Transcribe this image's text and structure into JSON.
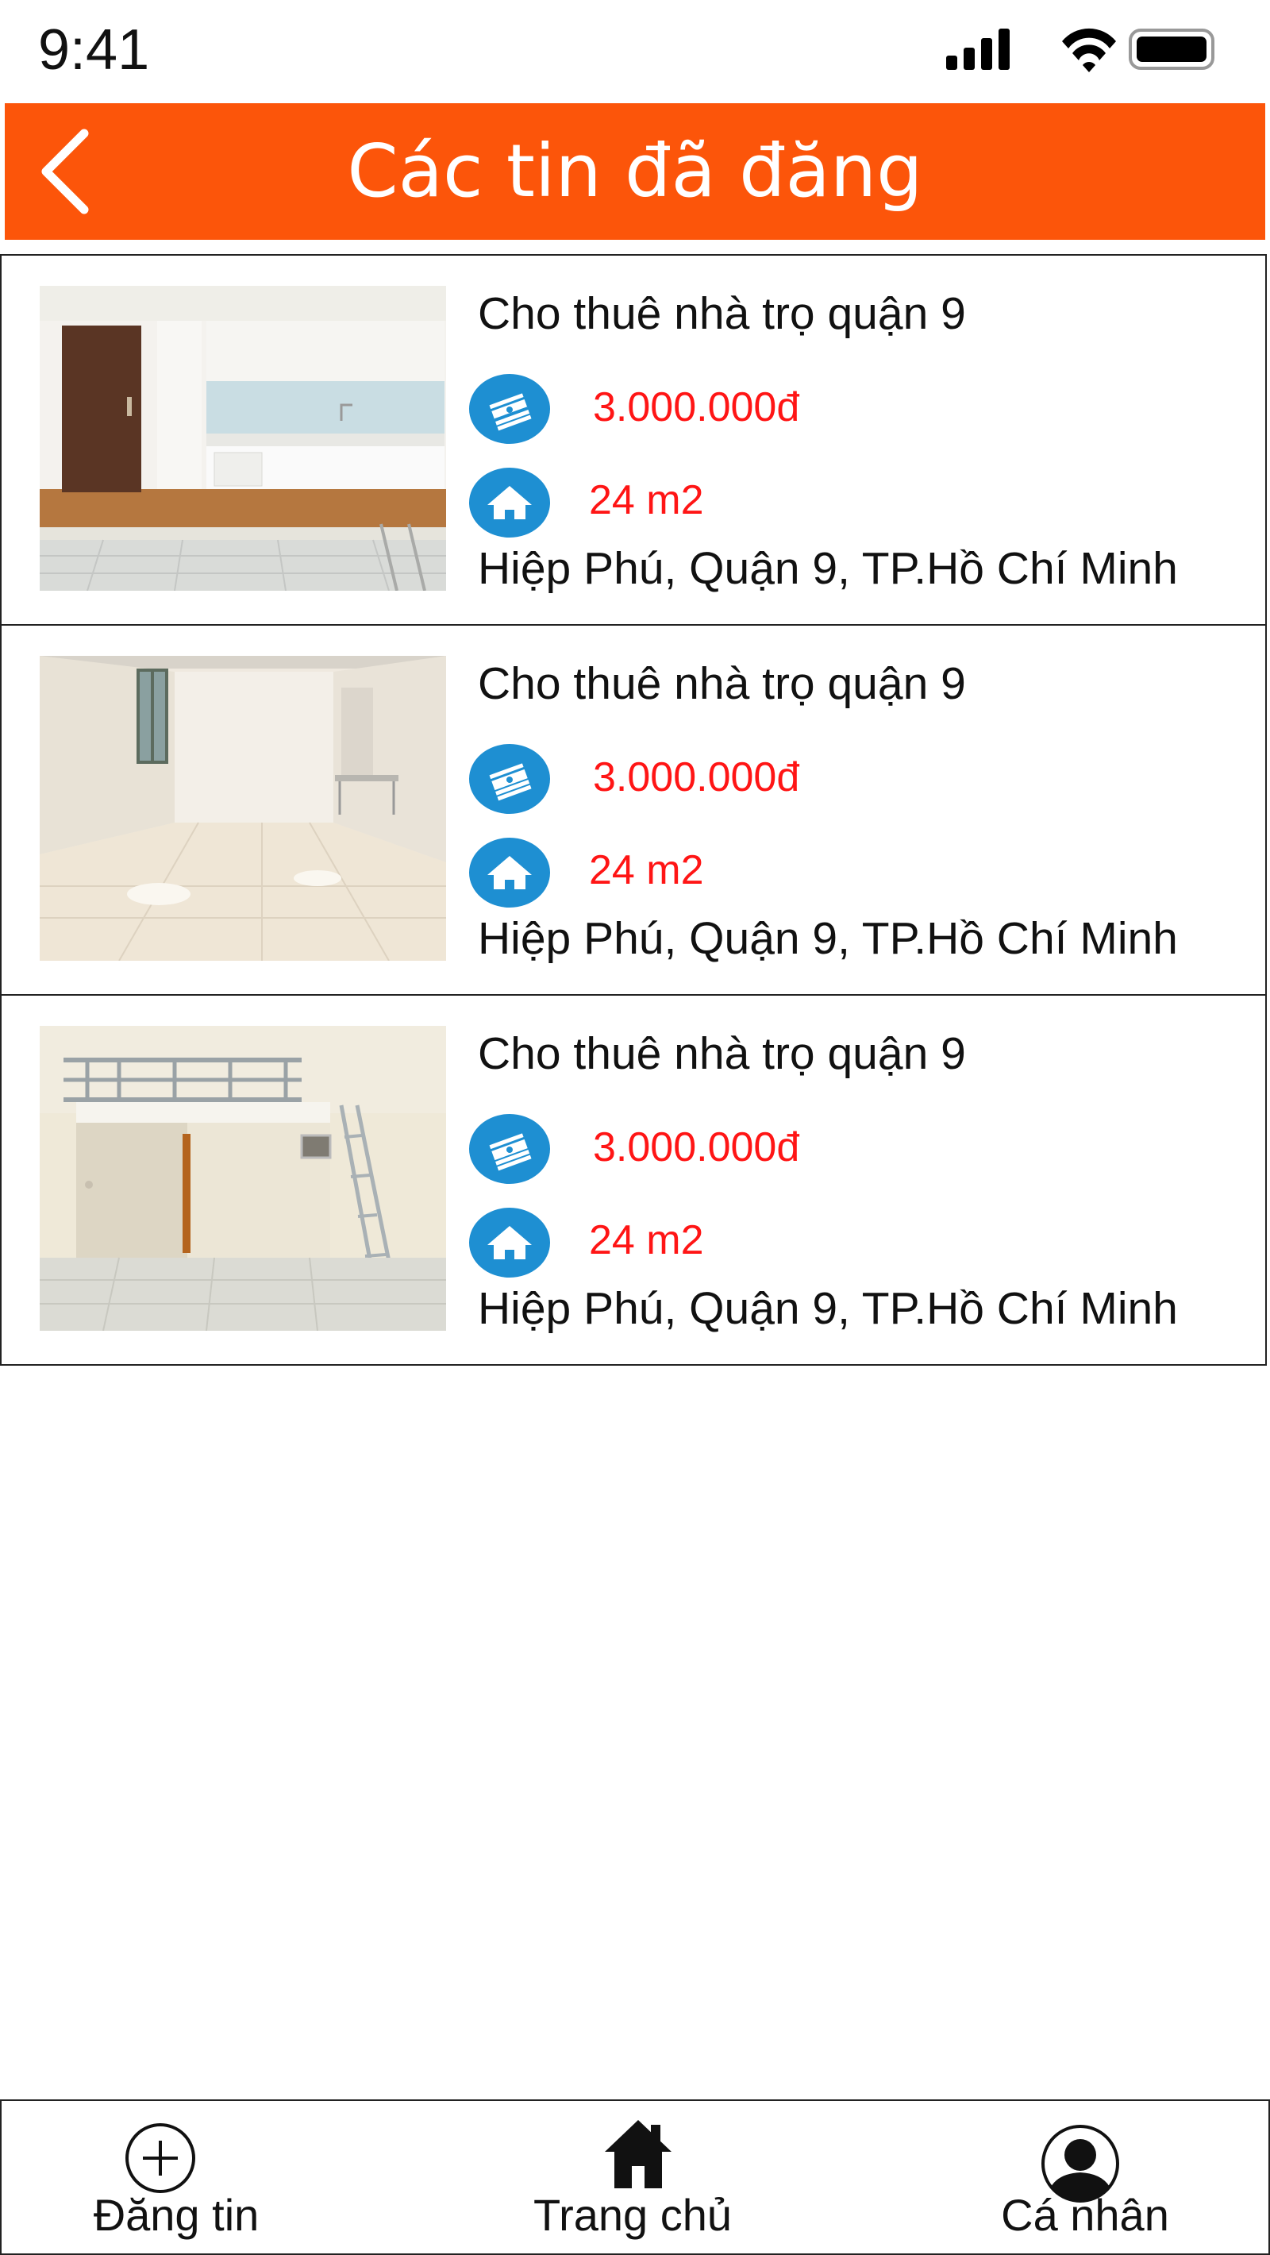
{
  "status_bar": {
    "time": "9:41"
  },
  "header": {
    "title": "Các tin đã đăng",
    "background": "#fc550a"
  },
  "listings": [
    {
      "title": "Cho thuê nhà trọ quận 9",
      "price": "3.000.000đ",
      "area": "24 m2",
      "address": "Hiệp Phú, Quận 9, TP.Hồ Chí Minh",
      "photo": "room-with-kitchen"
    },
    {
      "title": "Cho thuê nhà trọ quận 9",
      "price": "3.000.000đ",
      "area": "24 m2",
      "address": "Hiệp Phú, Quận 9, TP.Hồ Chí Minh",
      "photo": "empty-tiled-room"
    },
    {
      "title": "Cho thuê nhà trọ quận 9",
      "price": "3.000.000đ",
      "area": "24 m2",
      "address": "Hiệp Phú, Quận 9, TP.Hồ Chí Minh",
      "photo": "room-with-loft-ladder"
    }
  ],
  "tabbar": {
    "post_label": "Đăng tin",
    "home_label": "Trang chủ",
    "profile_label": "Cá nhân"
  },
  "colors": {
    "accent": "#fc550a",
    "price_text": "#ff1515",
    "icon_circle": "#1e8fd2"
  }
}
